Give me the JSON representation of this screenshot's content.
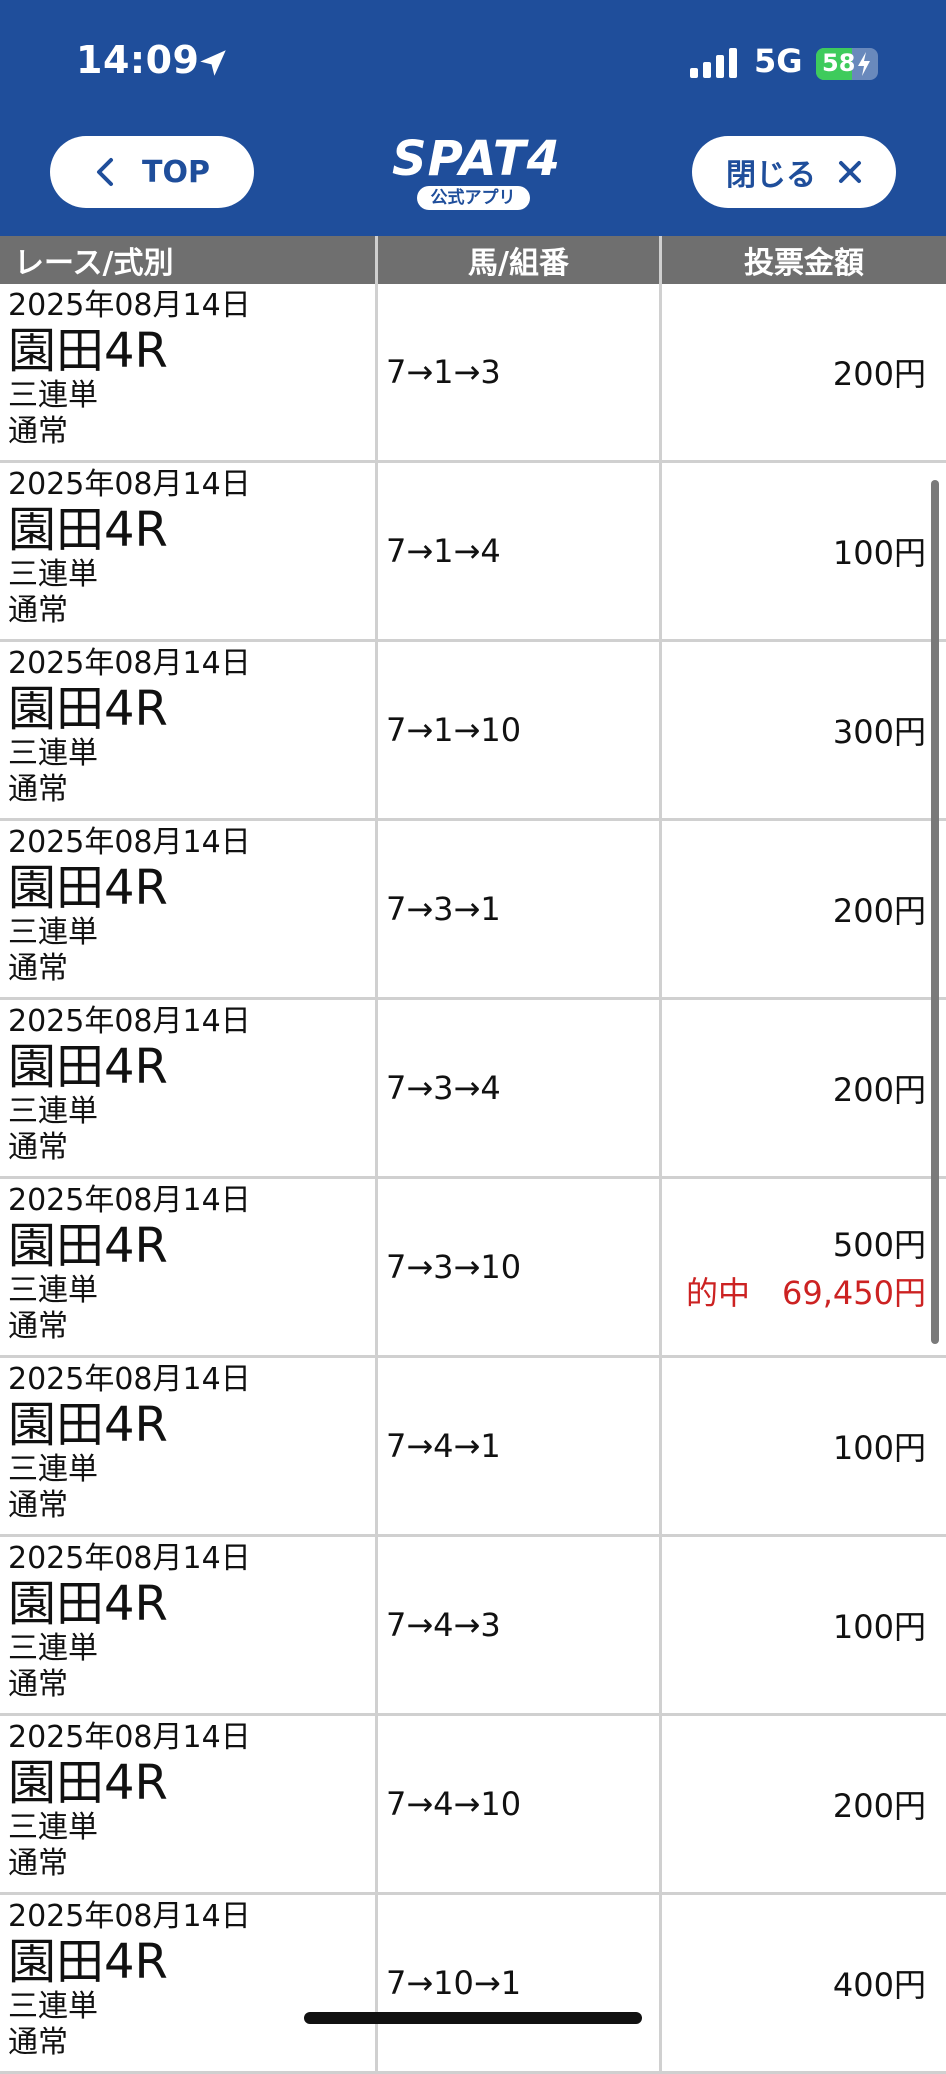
{
  "status": {
    "time": "14:09",
    "network": "5G",
    "battery": "58",
    "battery_level": 0.58
  },
  "header": {
    "back_label": "TOP",
    "logo_main": "SPAT4",
    "logo_sub": "公式アプリ",
    "close_label": "閉じる"
  },
  "table": {
    "columns": [
      "レース/式別",
      "馬/組番",
      "投票金額"
    ],
    "rows": [
      {
        "date": "2025年08月14日",
        "race": "園田4R",
        "type": "三連単",
        "mode": "通常",
        "combo": "7→1→3",
        "amount": "200円"
      },
      {
        "date": "2025年08月14日",
        "race": "園田4R",
        "type": "三連単",
        "mode": "通常",
        "combo": "7→1→4",
        "amount": "100円"
      },
      {
        "date": "2025年08月14日",
        "race": "園田4R",
        "type": "三連単",
        "mode": "通常",
        "combo": "7→1→10",
        "amount": "300円"
      },
      {
        "date": "2025年08月14日",
        "race": "園田4R",
        "type": "三連単",
        "mode": "通常",
        "combo": "7→3→1",
        "amount": "200円"
      },
      {
        "date": "2025年08月14日",
        "race": "園田4R",
        "type": "三連単",
        "mode": "通常",
        "combo": "7→3→4",
        "amount": "200円"
      },
      {
        "date": "2025年08月14日",
        "race": "園田4R",
        "type": "三連単",
        "mode": "通常",
        "combo": "7→3→10",
        "amount": "500円",
        "hit": "的中　69,450円"
      },
      {
        "date": "2025年08月14日",
        "race": "園田4R",
        "type": "三連単",
        "mode": "通常",
        "combo": "7→4→1",
        "amount": "100円"
      },
      {
        "date": "2025年08月14日",
        "race": "園田4R",
        "type": "三連単",
        "mode": "通常",
        "combo": "7→4→3",
        "amount": "100円"
      },
      {
        "date": "2025年08月14日",
        "race": "園田4R",
        "type": "三連単",
        "mode": "通常",
        "combo": "7→4→10",
        "amount": "200円"
      },
      {
        "date": "2025年08月14日",
        "race": "園田4R",
        "type": "三連単",
        "mode": "通常",
        "combo": "7→10→1",
        "amount": "400円"
      }
    ]
  },
  "colors": {
    "header_bg": "#1f4e9b",
    "table_header_bg": "#6f6f6f",
    "hit_text": "#cc2222"
  }
}
